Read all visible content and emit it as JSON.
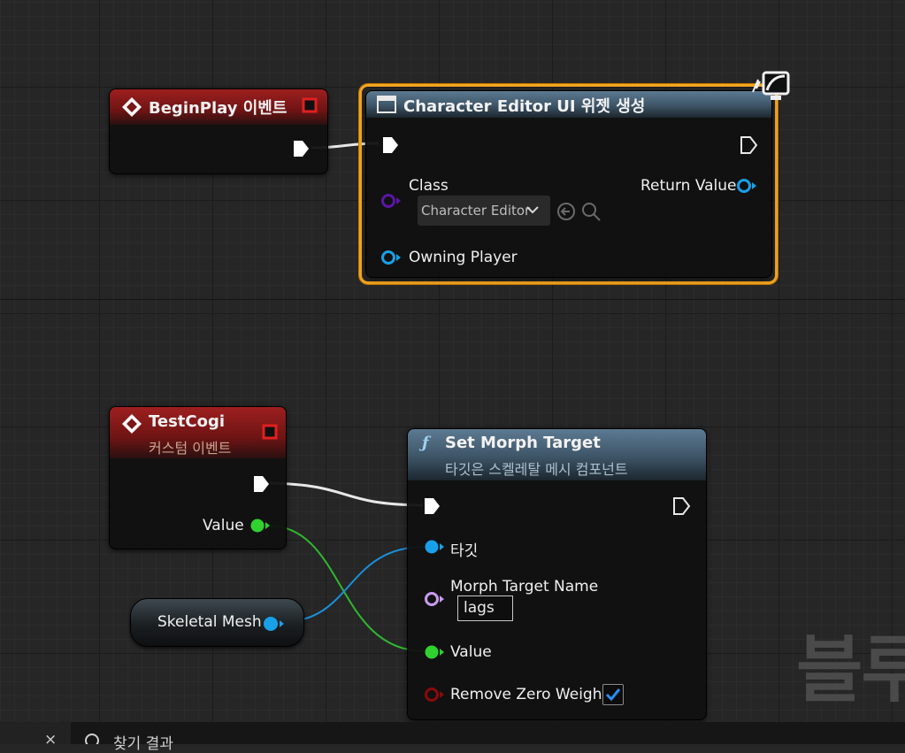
{
  "nodes": {
    "begin_play": {
      "title": "BeginPlay 이벤트"
    },
    "create_widget": {
      "title": "Character Editor UI 위젯 생성",
      "class_label": "Class",
      "class_value": "Character Editor",
      "return_label": "Return Value",
      "owning_label": "Owning Player"
    },
    "test_cogi": {
      "title": "TestCogi",
      "subtitle": "커스텀 이벤트",
      "value_label": "Value"
    },
    "skeletal_mesh": {
      "label": "Skeletal Mesh"
    },
    "set_morph": {
      "title": "Set Morph Target",
      "subtitle": "타깃은 스켈레탈 메시 컴포넌트",
      "target_label": "타깃",
      "morph_name_label": "Morph Target Name",
      "morph_name_value": "lags",
      "value_label": "Value",
      "remove_zero_label": "Remove Zero Weight",
      "remove_zero_checked": true
    }
  },
  "colors": {
    "exec": "#ffffff",
    "float_pin": "#2fd22f",
    "object_pin": "#18a0e8",
    "class_pin": "#5a16a8",
    "name_pin": "#c89cf0",
    "bool_pin": "#8b0a0a",
    "selection": "#f3a521"
  },
  "watermark": "블루",
  "bottom_bar": {
    "tab_close": "×",
    "search_label": "찾기 결과"
  }
}
